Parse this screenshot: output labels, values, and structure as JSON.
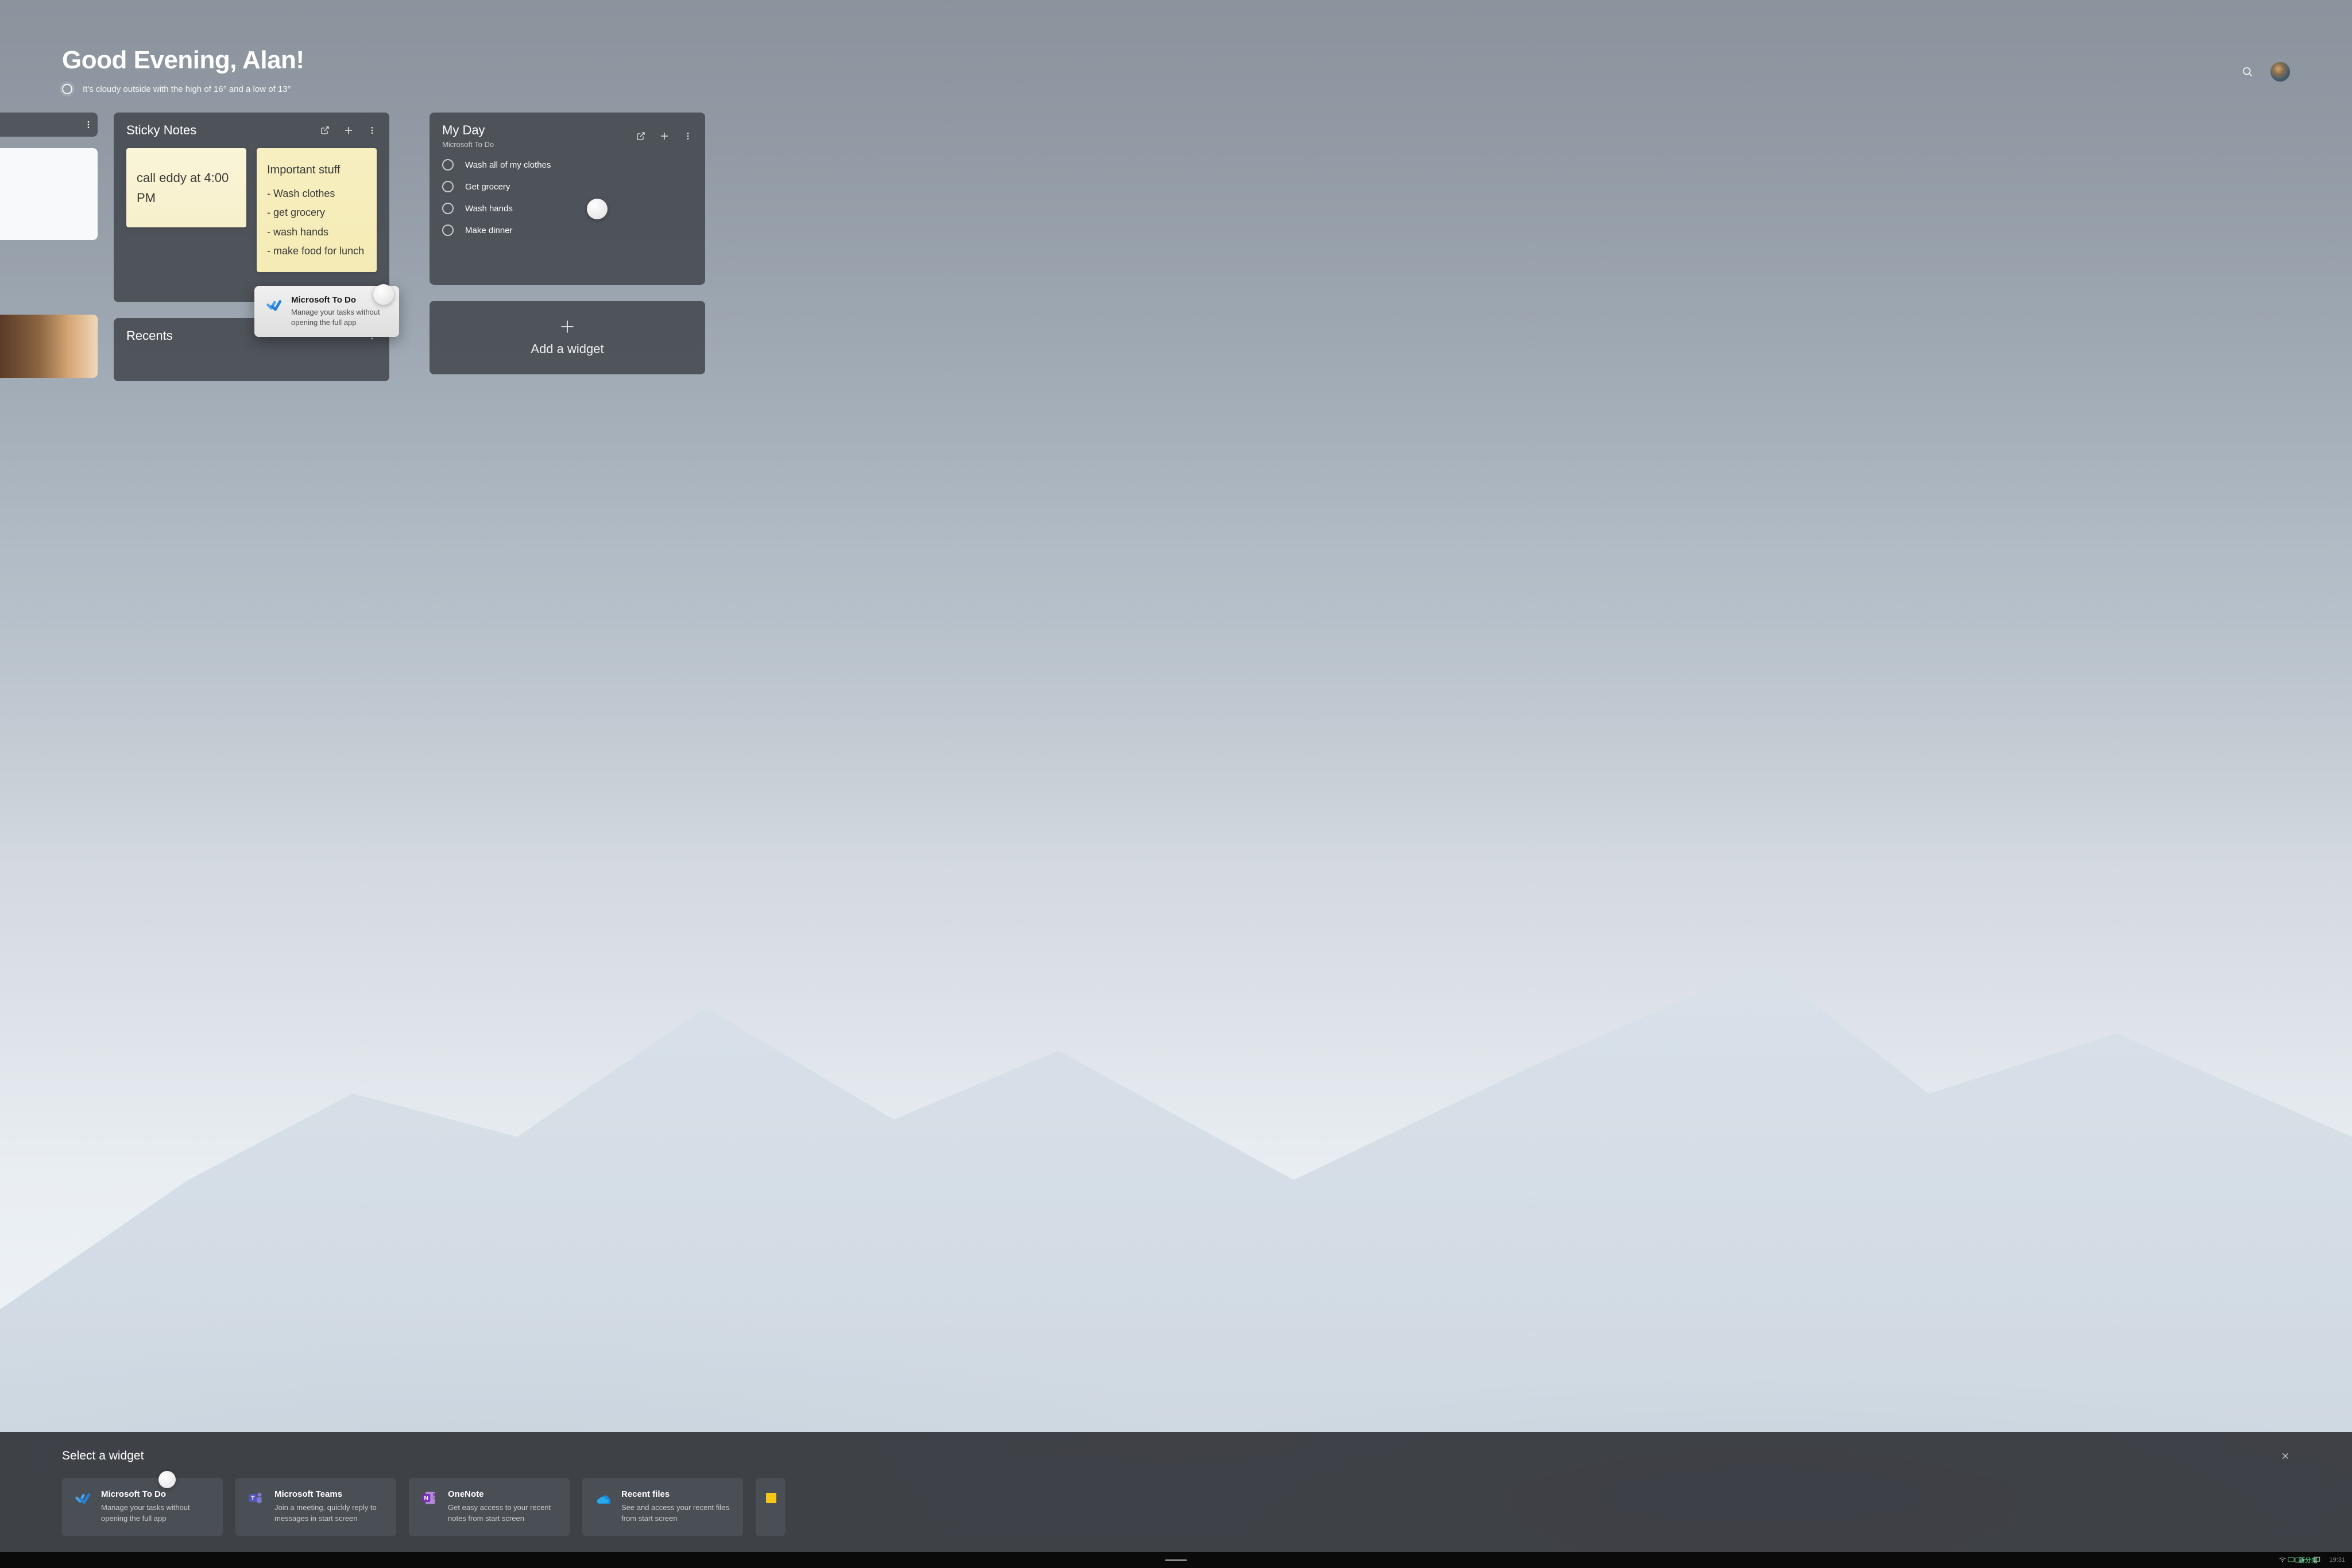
{
  "header": {
    "greeting": "Good Evening, Alan!",
    "weather": "It's cloudy outside with the high of 16° and a low of 13°"
  },
  "widgets": {
    "sticky": {
      "title": "Sticky Notes",
      "note1": "call eddy at 4:00 PM",
      "note2_title": "Important stuff",
      "note2_items": [
        "- Wash clothes",
        "- get grocery",
        "- wash hands",
        "- make food for lunch"
      ]
    },
    "myday": {
      "title": "My Day",
      "subtitle": "Microsoft To Do",
      "tasks": [
        "Wash all of my clothes",
        "Get grocery",
        "Wash hands",
        "Make dinner"
      ]
    },
    "recents": {
      "title": "Recents"
    },
    "add": {
      "label": "Add a widget"
    }
  },
  "tooltip": {
    "title": "Microsoft To Do",
    "desc": "Manage your tasks without opening the full app"
  },
  "panel": {
    "title": "Select a widget",
    "cards": [
      {
        "title": "Microsoft To Do",
        "desc": "Manage your tasks without opening the full app"
      },
      {
        "title": "Microsoft Teams",
        "desc": "Join a meeting, quickly reply to messages in start screen"
      },
      {
        "title": "OneNote",
        "desc": "Get easy access to your recent notes from start screen"
      },
      {
        "title": "Recent files",
        "desc": "See and access your recent files from start screen"
      }
    ]
  },
  "taskbar": {
    "time": "19:31"
  }
}
